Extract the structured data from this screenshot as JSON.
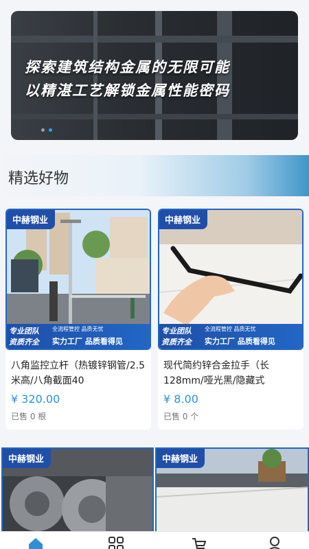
{
  "banner": {
    "line1": "探索建筑结构金属的无限可能",
    "line2": "以精湛工艺解锁金属性能密码"
  },
  "section": {
    "title": "精选好物"
  },
  "products": [
    {
      "brand": "中赫钢业",
      "tag_team": "专业团队",
      "tag_full": "资质齐全",
      "tag_mini": "全流程管控  品质无忧",
      "tag_factory": "实力工厂  品质看得见",
      "title": "八角监控立杆（热镀锌钢管/2.5米高/八角截面40",
      "price": "¥ 320.00",
      "sold": "已售 0 根"
    },
    {
      "brand": "中赫钢业",
      "tag_team": "专业团队",
      "tag_full": "资质齐全",
      "tag_mini": "全流程管控  品质无忧",
      "tag_factory": "实力工厂  品质看得见",
      "title": "现代简约锌合金拉手（长128mm/哑光黑/隐藏式",
      "price": "¥ 8.00",
      "sold": "已售 0 个"
    },
    {
      "brand": "中赫钢业"
    },
    {
      "brand": "中赫钢业"
    }
  ],
  "tabbar": {
    "icons": [
      "home-icon",
      "grid-icon",
      "cart-icon",
      "user-icon"
    ],
    "active_color": "#2f8fd8"
  }
}
